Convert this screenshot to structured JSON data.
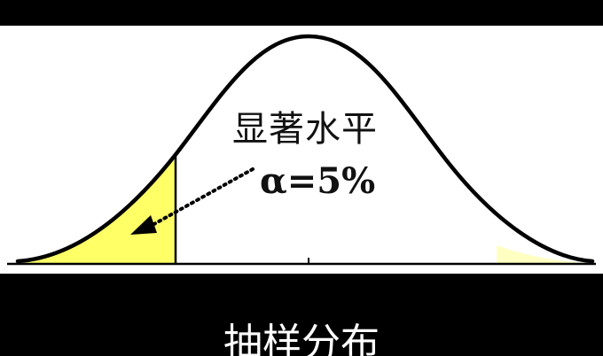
{
  "diagram": {
    "significance_label": "显著水平",
    "alpha_label": "α=5%",
    "caption": "抽样分布",
    "colors": {
      "curve": "#000000",
      "rejection_region": "#ffff66",
      "background": "#ffffff",
      "frame": "#000000"
    }
  }
}
